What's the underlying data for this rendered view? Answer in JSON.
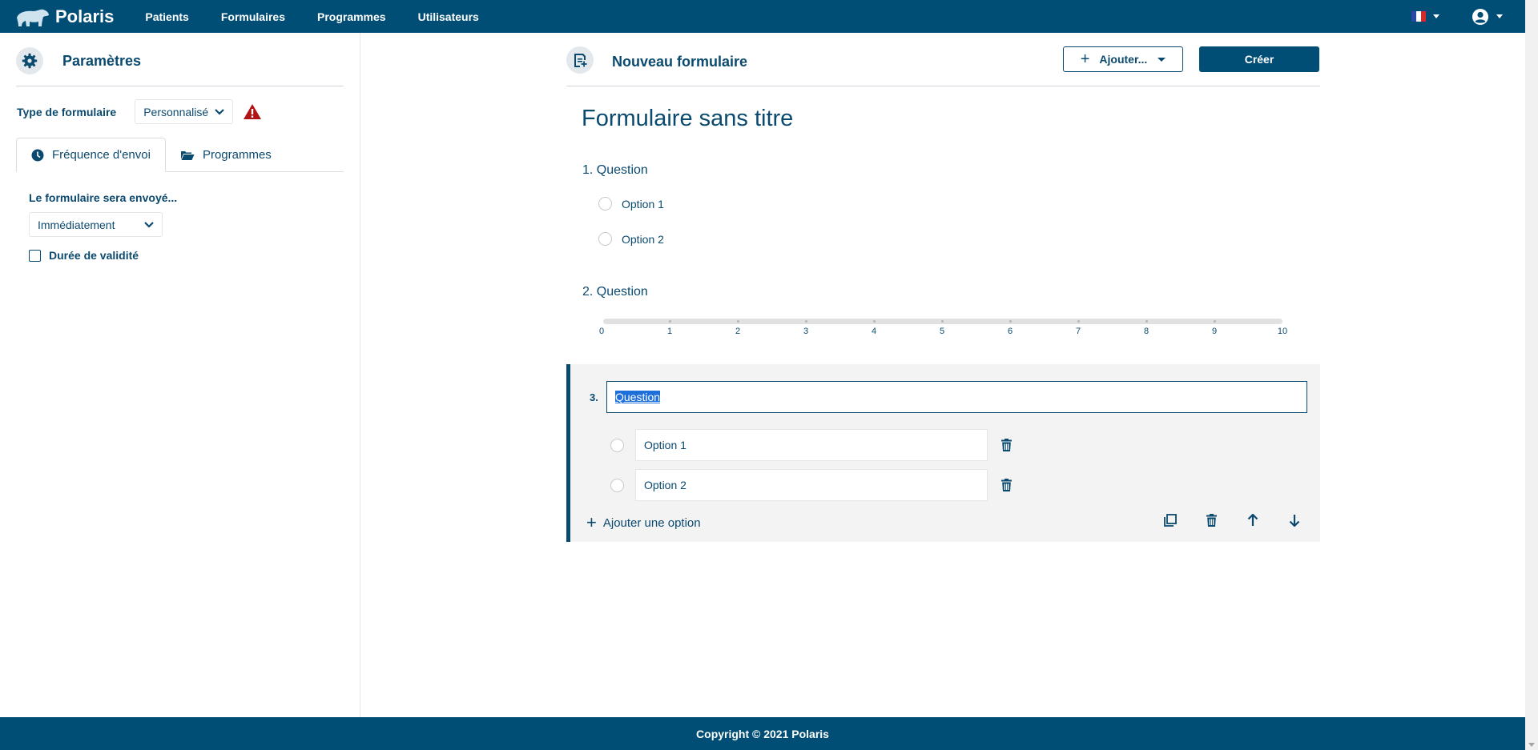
{
  "navbar": {
    "brand": "Polaris",
    "links": [
      "Patients",
      "Formulaires",
      "Programmes",
      "Utilisateurs"
    ],
    "language_icon": "france-flag-icon",
    "user_icon": "user-circle-icon"
  },
  "sidebar": {
    "title": "Paramètres",
    "type_label": "Type de formulaire",
    "type_value": "Personnalisé",
    "tabs": [
      {
        "label": "Fréquence d'envoi",
        "icon": "clock-icon",
        "active": true
      },
      {
        "label": "Programmes",
        "icon": "folder-open-icon",
        "active": false
      }
    ],
    "send_label": "Le formulaire sera envoyé...",
    "send_value": "Immédiatement",
    "validity_label": "Durée de validité",
    "validity_checked": false
  },
  "main": {
    "title": "Nouveau formulaire",
    "add_button": "Ajouter...",
    "create_button": "Créer",
    "form_title": "Formulaire sans titre",
    "questions": [
      {
        "label": "1. Question",
        "type": "radio",
        "options": [
          "Option 1",
          "Option 2"
        ]
      },
      {
        "label": "2. Question",
        "type": "scale",
        "ticks": [
          "0",
          "1",
          "2",
          "3",
          "4",
          "5",
          "6",
          "7",
          "8",
          "9",
          "10"
        ]
      }
    ],
    "active_question": {
      "number": "3.",
      "value": "Question",
      "options": [
        "Option 1",
        "Option 2"
      ],
      "add_option": "Ajouter une option"
    }
  },
  "footer": {
    "text": "Copyright © 2021 Polaris"
  },
  "colors": {
    "primary": "#004e75",
    "text": "#0b4a6f",
    "warning": "#b01414"
  }
}
